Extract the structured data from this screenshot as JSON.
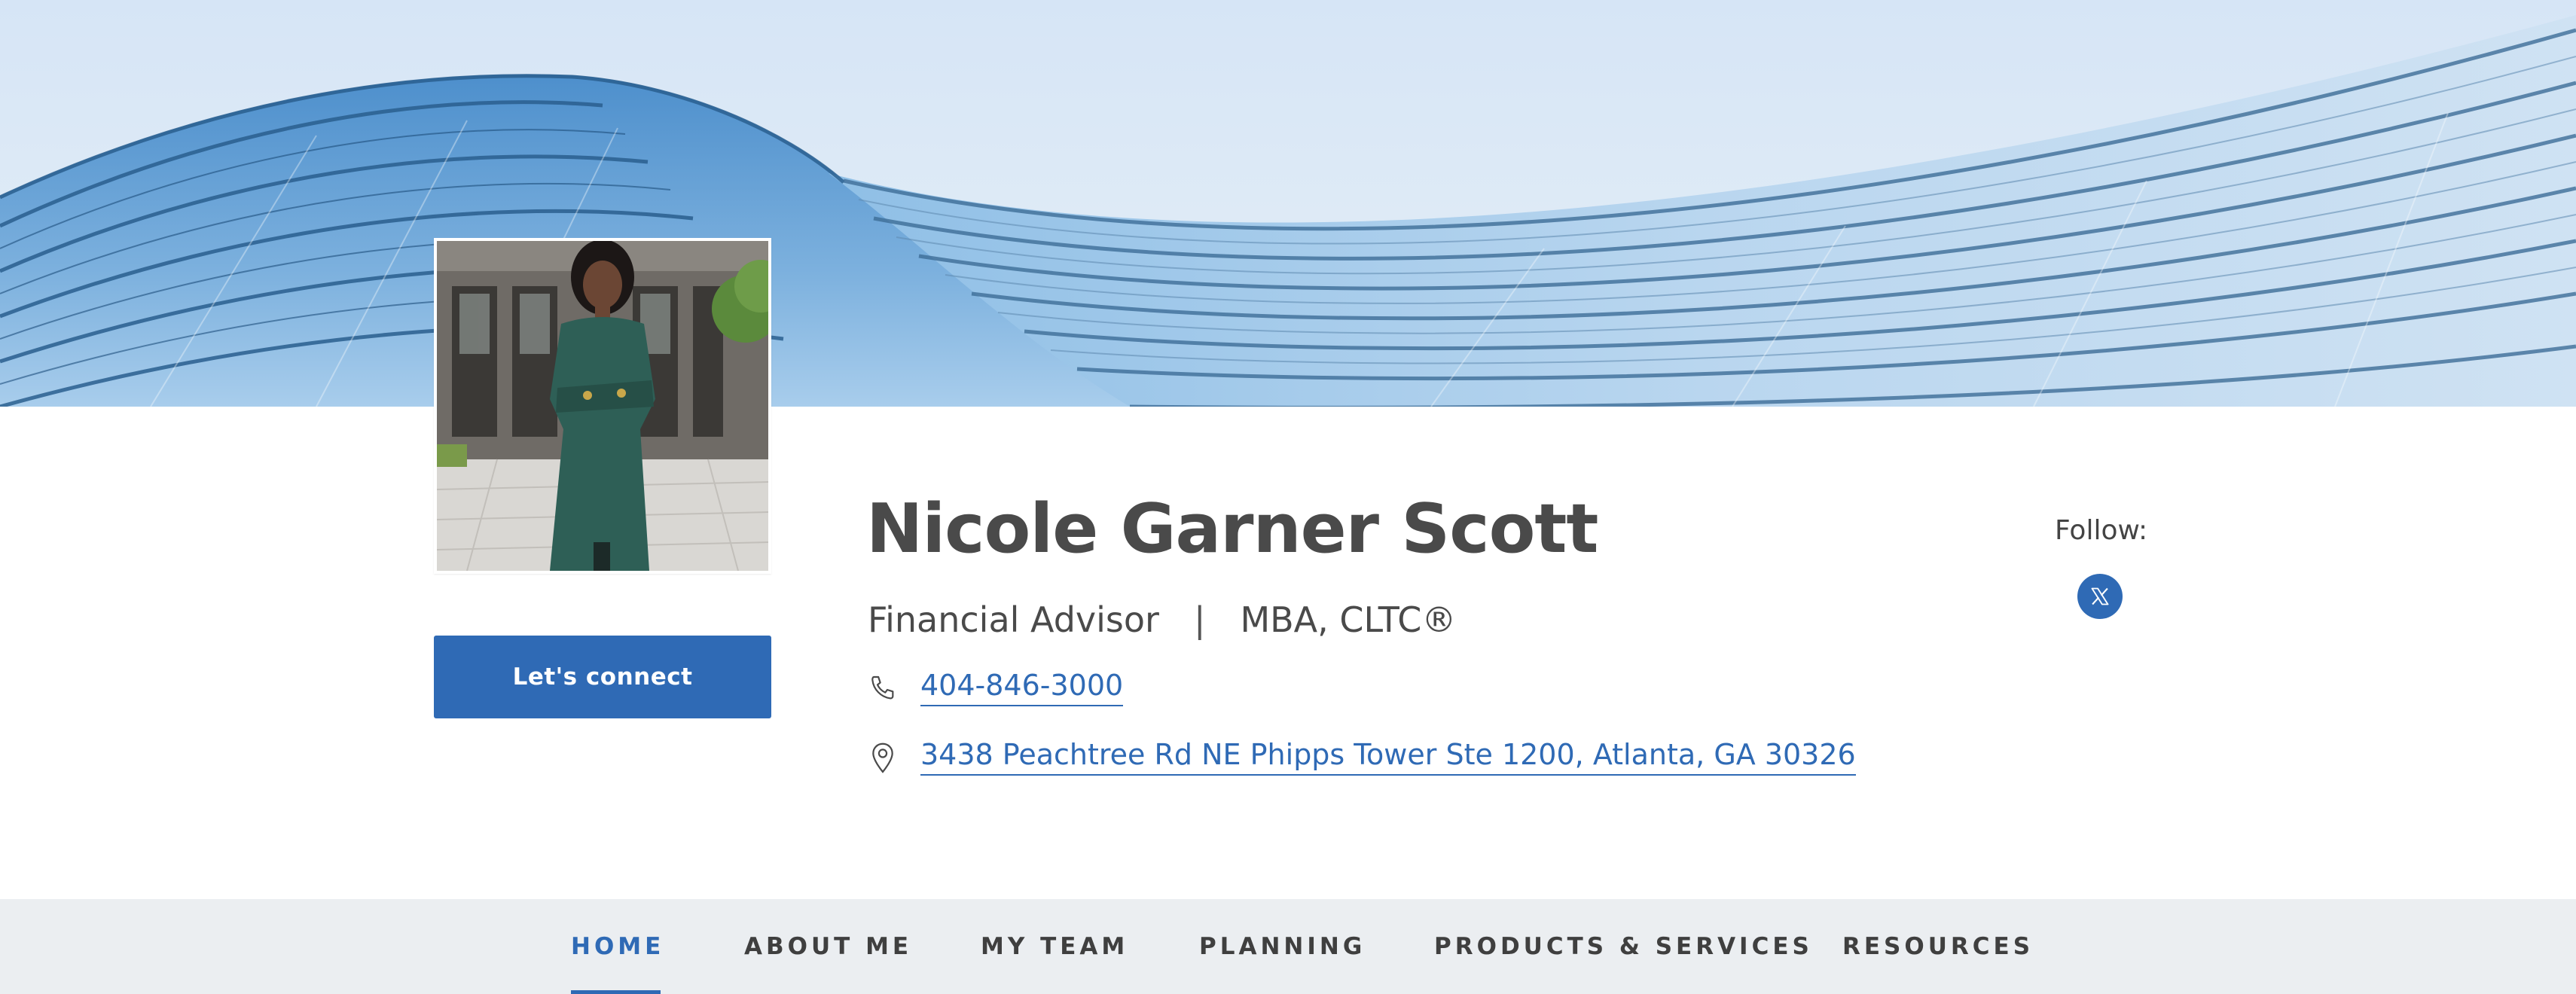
{
  "profile": {
    "name": "Nicole Garner Scott",
    "title": "Financial Advisor",
    "separator": "|",
    "credentials": "MBA, CLTC®",
    "phone": "404-846-3000",
    "address": "3438 Peachtree Rd NE Phipps Tower Ste 1200, Atlanta, GA 30326",
    "connect_label": "Let's connect"
  },
  "follow": {
    "label": "Follow:",
    "icon": "x-twitter-icon"
  },
  "nav": {
    "items": [
      {
        "label": "HOME",
        "active": true
      },
      {
        "label": "ABOUT ME",
        "active": false
      },
      {
        "label": "MY TEAM",
        "active": false
      },
      {
        "label": "PLANNING",
        "active": false
      },
      {
        "label": "PRODUCTS & SERVICES",
        "active": false
      },
      {
        "label": "RESOURCES",
        "active": false
      }
    ]
  },
  "colors": {
    "accent": "#2f6ab5",
    "nav_bg": "#ebeef1",
    "text": "#4a4a4a"
  }
}
